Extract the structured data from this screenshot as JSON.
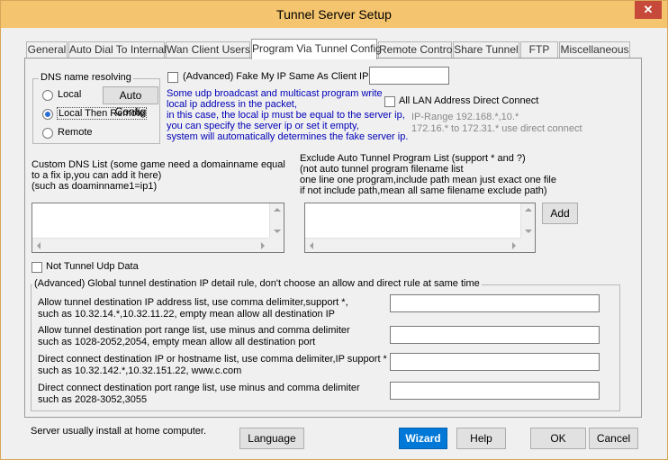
{
  "window": {
    "title": "Tunnel Server Setup",
    "close_glyph": "✕"
  },
  "tabs": [
    {
      "label": "General"
    },
    {
      "label": "Auto Dial To Internal"
    },
    {
      "label": "Wan Client Users"
    },
    {
      "label": "Program Via Tunnel Config"
    },
    {
      "label": "Remote Control"
    },
    {
      "label": "Share Tunnel"
    },
    {
      "label": "FTP"
    },
    {
      "label": "Miscellaneous"
    }
  ],
  "dns": {
    "group_label": "DNS name resolving",
    "options": [
      {
        "label": "Local",
        "checked": false
      },
      {
        "label": "Local Then Remote",
        "checked": true
      },
      {
        "label": "Remote",
        "checked": false
      }
    ],
    "auto_config_label": "Auto Config"
  },
  "fake_ip": {
    "label": "(Advanced) Fake My IP Same As Client IP:",
    "value": "",
    "help_lines": [
      "Some udp broadcast and multicast program write",
      "local ip address in the packet,",
      "in this case, the local ip must be equal to the server ip,",
      "you can specify the server ip or set it empty,",
      "system will automatically determines the fake server ip."
    ]
  },
  "lan_direct": {
    "label": "All LAN Address Direct Connect",
    "help_lines": [
      "IP-Range 192.168.*,10.*",
      "172.16.* to 172.31.* use direct connect"
    ]
  },
  "custom_dns": {
    "label_lines": [
      "Custom DNS List (some game need a domainname equal",
      " to a fix ip,you can add it here)",
      "(such as  doaminname1=ip1)"
    ],
    "value": ""
  },
  "exclude": {
    "label_lines": [
      "Exclude Auto Tunnel Program List (support * and ?)",
      "(not auto tunnel program filename list",
      "one line one program,include path mean just exact one file",
      "if not include path,mean all same filename exclude path)"
    ],
    "value": "",
    "add_label": "Add"
  },
  "not_tunnel_udp": {
    "label": "Not Tunnel Udp Data"
  },
  "global_rule": {
    "group_label": "(Advanced) Global tunnel destination IP detail rule, don't choose an allow and direct rule at same time",
    "rows": [
      {
        "line1": "Allow tunnel destination IP address list, use comma delimiter,support *,",
        "line2": "such as 10.32.14.*,10.32.11.22, empty mean allow all destination IP",
        "value": ""
      },
      {
        "line1": "Allow tunnel destination port range list, use minus and comma delimiter",
        "line2": "such as 1028-2052,2054, empty mean allow all destination port",
        "value": ""
      },
      {
        "line1": "Direct connect destination IP or hostname list, use comma delimiter,IP support *",
        "line2": "such as 10.32.142.*,10.32.151.22, www.c.com",
        "value": ""
      },
      {
        "line1": "Direct connect destination port range list, use minus and comma delimiter",
        "line2": "such as 2028-3052,3055",
        "value": ""
      }
    ]
  },
  "footer": {
    "note": "Server usually install at home computer.",
    "language_label": "Language",
    "wizard_label": "Wizard",
    "help_label": "Help",
    "ok_label": "OK",
    "cancel_label": "Cancel"
  },
  "colors": {
    "titlebar": "#f5c46e",
    "close_button": "#c7493a",
    "primary_button": "#0078d7",
    "help_text_blue": "#0000b8"
  }
}
